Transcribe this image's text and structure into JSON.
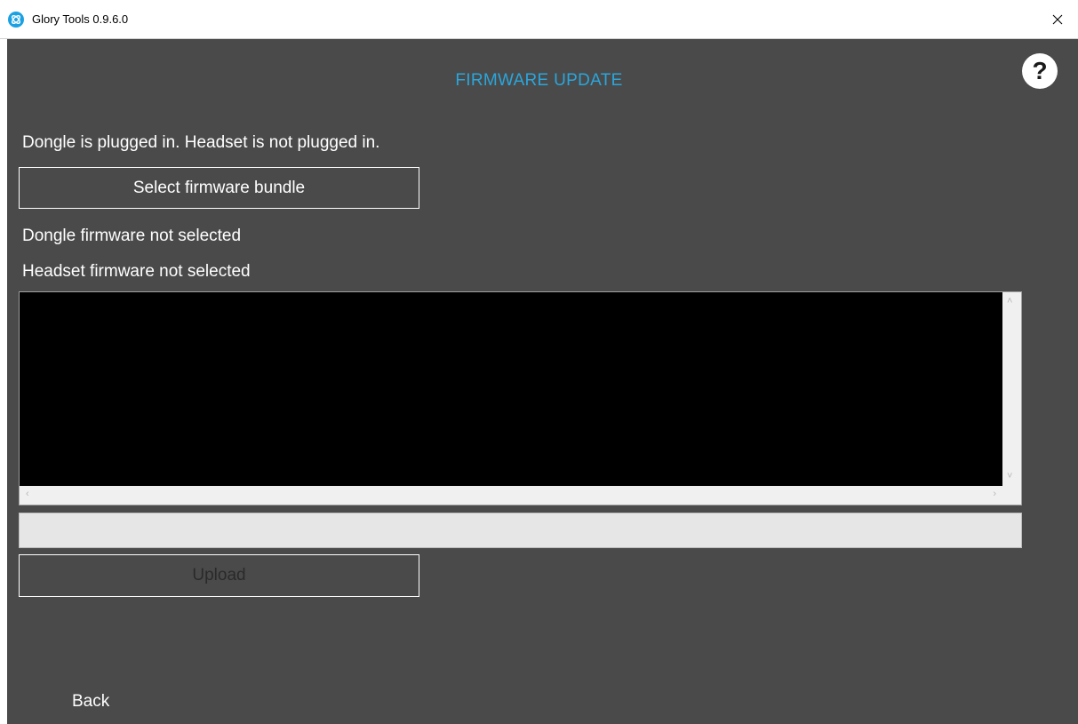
{
  "window": {
    "title": "Glory Tools 0.9.6.0",
    "app_icon": "glory-logo-icon",
    "close_icon": "close-icon"
  },
  "header": {
    "title": "FIRMWARE UPDATE",
    "help_label": "?",
    "accent_color": "#2aa6dc"
  },
  "status": {
    "connection": "Dongle is plugged in. Headset is not plugged in."
  },
  "actions": {
    "select_label": "Select firmware bundle",
    "upload_label": "Upload",
    "upload_enabled": false
  },
  "firmware": {
    "dongle": "Dongle firmware not selected",
    "headset": "Headset firmware not selected"
  },
  "log": {
    "text": ""
  },
  "progress": {
    "value": 0
  },
  "nav": {
    "back_label": "Back"
  },
  "colors": {
    "background": "#4a4a4a",
    "log_background": "#000000",
    "progress_track": "#e6e6e6"
  }
}
